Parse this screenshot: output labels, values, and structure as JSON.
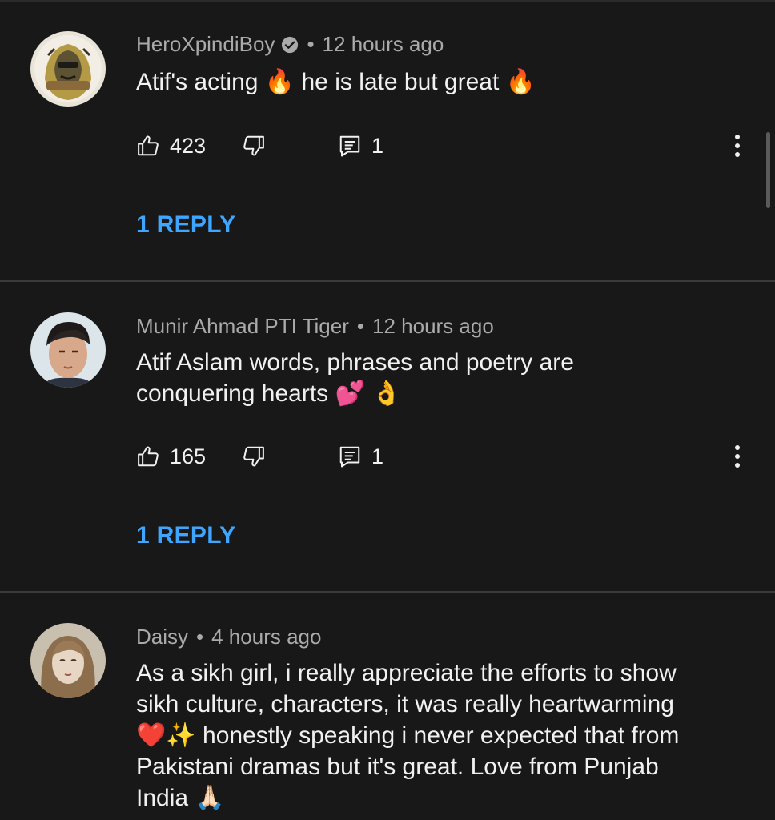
{
  "comments": [
    {
      "author": "HeroXpindiBoy",
      "verified": true,
      "time": "12 hours ago",
      "text_lines": [
        "Atif's acting 🔥  he is late but great 🔥"
      ],
      "likes": "423",
      "replies_count": "1",
      "reply_link": "1 REPLY"
    },
    {
      "author": "Munir Ahmad PTI Tiger",
      "verified": false,
      "time": "12 hours ago",
      "text_lines": [
        "Atif Aslam words, phrases and poetry are",
        "conquering hearts 💕 👌"
      ],
      "likes": "165",
      "replies_count": "1",
      "reply_link": "1 REPLY"
    },
    {
      "author": "Daisy",
      "verified": false,
      "time": "4 hours ago",
      "text_lines": [
        "As a sikh girl, i really appreciate the efforts to show",
        "sikh culture, characters, it was really heartwarming",
        "❤️✨ honestly speaking i never expected that from",
        "Pakistani dramas but it's great. Love from Punjab",
        "India 🙏🏻"
      ]
    }
  ],
  "separator": "•",
  "colors": {
    "background": "#181818",
    "meta_text": "#aaaaaa",
    "body_text": "#f1f1f1",
    "reply_link": "#3ea6ff",
    "divider": "#3a3a3a"
  },
  "icons": {
    "like": "thumbs-up-icon",
    "dislike": "thumbs-down-icon",
    "reply": "comment-icon",
    "more": "more-vertical-icon",
    "verified": "verified-check-icon"
  }
}
